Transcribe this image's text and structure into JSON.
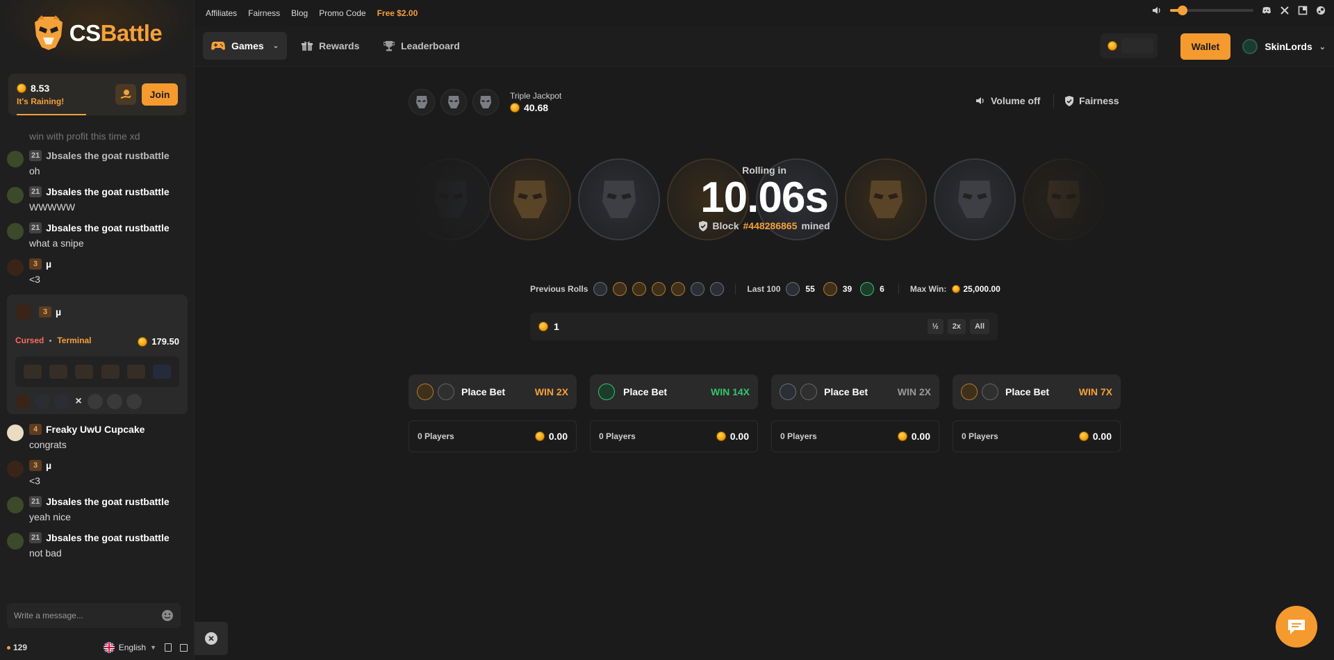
{
  "brand": {
    "cs": "CS",
    "battle": "Battle"
  },
  "rain": {
    "amount": "8.53",
    "status": "It's Raining!",
    "join_label": "Join"
  },
  "chat": {
    "partial_text": "win with profit this time xd",
    "messages": [
      {
        "level": "21",
        "user": "Jbsales the goat rustbattle",
        "text": "oh",
        "level_style": "gray"
      },
      {
        "level": "21",
        "user": "Jbsales the goat rustbattle",
        "text": "WWWWW",
        "level_style": "gray"
      },
      {
        "level": "21",
        "user": "Jbsales the goat rustbattle",
        "text": "what a snipe",
        "level_style": "gray"
      },
      {
        "level": "3",
        "user": "µ",
        "text": "<3",
        "level_style": "brown"
      }
    ],
    "battle_card": {
      "level": "3",
      "user": "µ",
      "mode_1": "Cursed",
      "mode_2": "Terminal",
      "amount": "179.50"
    },
    "messages_after": [
      {
        "level": "4",
        "user": "Freaky UwU Cupcake",
        "text": "congrats",
        "level_style": "brown"
      },
      {
        "level": "3",
        "user": "µ",
        "text": "<3",
        "level_style": "brown"
      },
      {
        "level": "21",
        "user": "Jbsales the goat rustbattle",
        "text": "yeah nice",
        "level_style": "gray"
      },
      {
        "level": "21",
        "user": "Jbsales the goat rustbattle",
        "text": "not bad",
        "level_style": "gray"
      }
    ],
    "input_placeholder": "Write a message...",
    "online_count": "129",
    "language": "English"
  },
  "topbar": {
    "links": [
      "Affiliates",
      "Fairness",
      "Blog",
      "Promo Code"
    ],
    "free_label": "Free $2.00",
    "volume_percent": 15
  },
  "navbar": {
    "games": "Games",
    "rewards": "Rewards",
    "leaderboard": "Leaderboard",
    "wallet": "Wallet",
    "username": "SkinLords"
  },
  "game": {
    "jackpot_label": "Triple Jackpot",
    "jackpot_value": "40.68",
    "volume_label": "Volume off",
    "fairness_label": "Fairness",
    "rolling_label": "Rolling in",
    "timer": "10.06s",
    "block_prefix": "Block",
    "block_number": "#448286865",
    "block_suffix": "mined",
    "previous_rolls_label": "Previous Rolls",
    "previous_rolls": [
      "gray",
      "gold",
      "gold",
      "gold",
      "gold",
      "gray",
      "gray"
    ],
    "last100_label": "Last 100",
    "last100": {
      "gray": "55",
      "gold": "39",
      "green": "6"
    },
    "max_win_label": "Max Win:",
    "max_win": "25,000.00",
    "bet_value": "1",
    "bet_buttons": [
      "½",
      "2x",
      "All"
    ],
    "bets": [
      {
        "label": "Place Bet",
        "win": "WIN 2X",
        "color": "gold",
        "players": "0 Players",
        "amount": "0.00"
      },
      {
        "label": "Place Bet",
        "win": "WIN 14X",
        "color": "green",
        "players": "0 Players",
        "amount": "0.00"
      },
      {
        "label": "Place Bet",
        "win": "WIN 2X",
        "color": "gray",
        "players": "0 Players",
        "amount": "0.00"
      },
      {
        "label": "Place Bet",
        "win": "WIN 7X",
        "color": "gold",
        "players": "0 Players",
        "amount": "0.00"
      }
    ]
  }
}
